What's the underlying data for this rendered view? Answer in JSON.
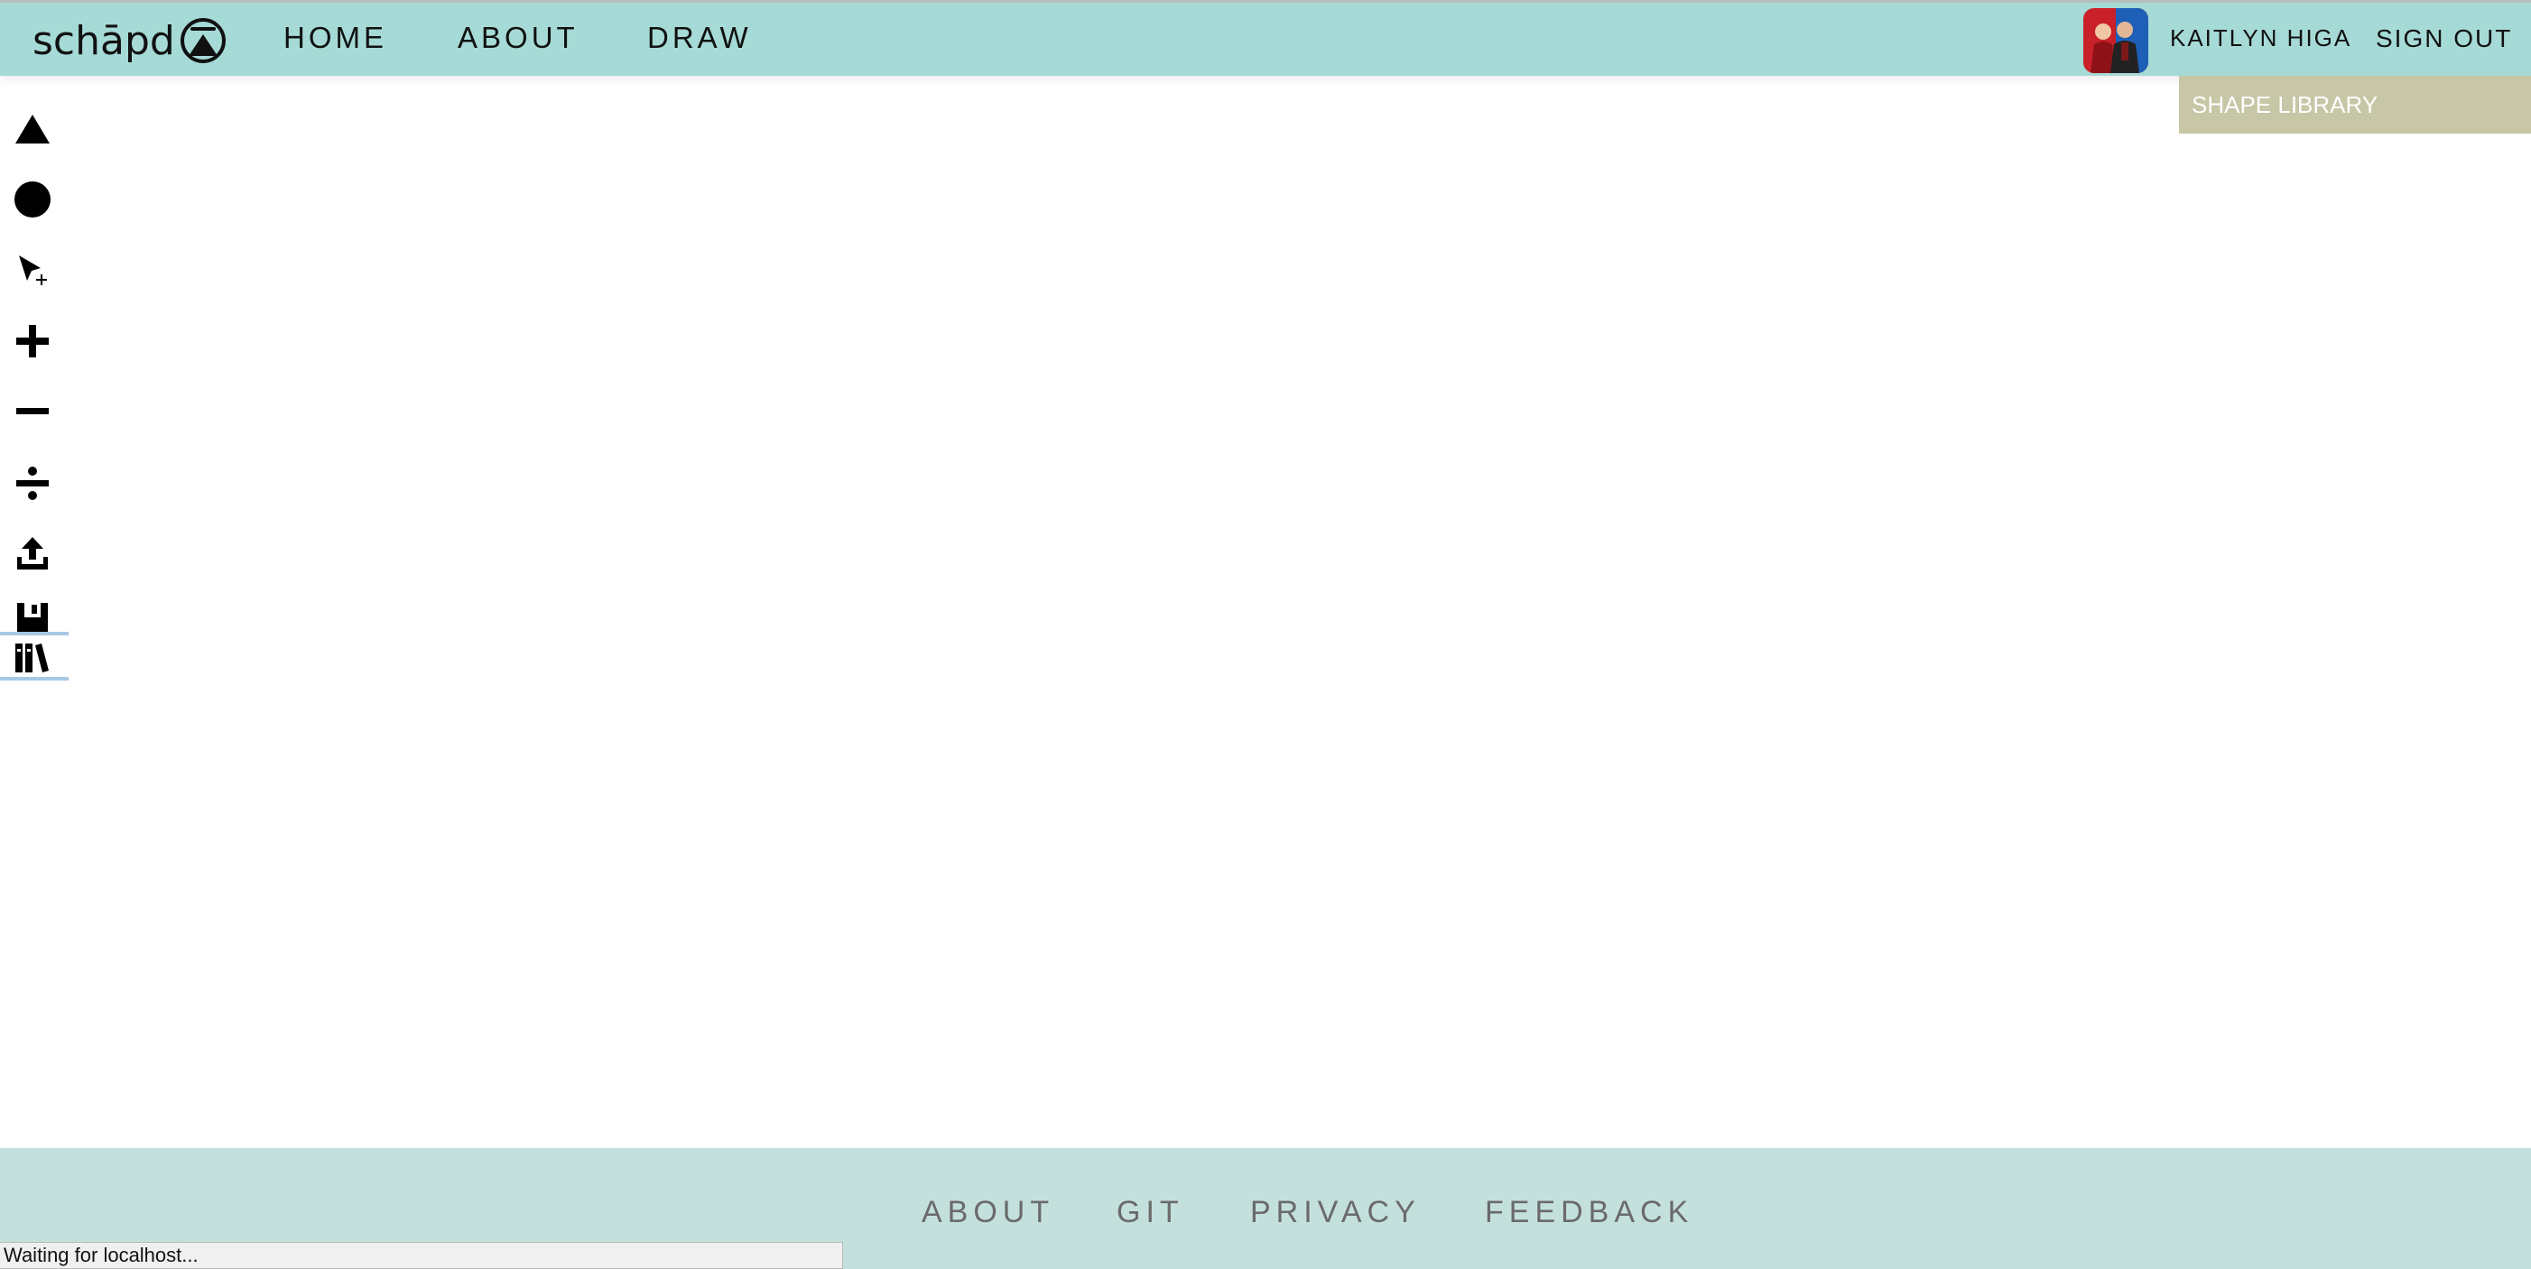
{
  "brand": {
    "logo_text": "schāpd",
    "logo_icon": "mountain-circle-icon"
  },
  "nav": {
    "items": [
      {
        "label": "HOME"
      },
      {
        "label": "ABOUT"
      },
      {
        "label": "DRAW"
      }
    ]
  },
  "user": {
    "name": "KAITLYN HIGA",
    "avatar_icon": "user-avatar",
    "sign_out_label": "SIGN OUT"
  },
  "shape_library": {
    "label": "SHAPE LIBRARY"
  },
  "toolbar": {
    "tools": [
      {
        "icon": "triangle-icon"
      },
      {
        "icon": "circle-icon"
      },
      {
        "icon": "pointer-add-icon"
      },
      {
        "icon": "plus-icon"
      },
      {
        "icon": "minus-icon"
      },
      {
        "icon": "divide-icon"
      },
      {
        "icon": "upload-icon"
      },
      {
        "icon": "save-icon"
      },
      {
        "icon": "library-icon",
        "active": true
      }
    ]
  },
  "footer": {
    "links": [
      {
        "label": "ABOUT"
      },
      {
        "label": "GIT"
      },
      {
        "label": "PRIVACY"
      },
      {
        "label": "FEEDBACK"
      }
    ]
  },
  "status": {
    "text": "Waiting for localhost..."
  },
  "colors": {
    "header_bg": "#a6dad6",
    "footer_bg": "#c4e0dd",
    "shape_library_bg": "#c7c6a6",
    "active_tool_border": "#a6c8e4"
  }
}
